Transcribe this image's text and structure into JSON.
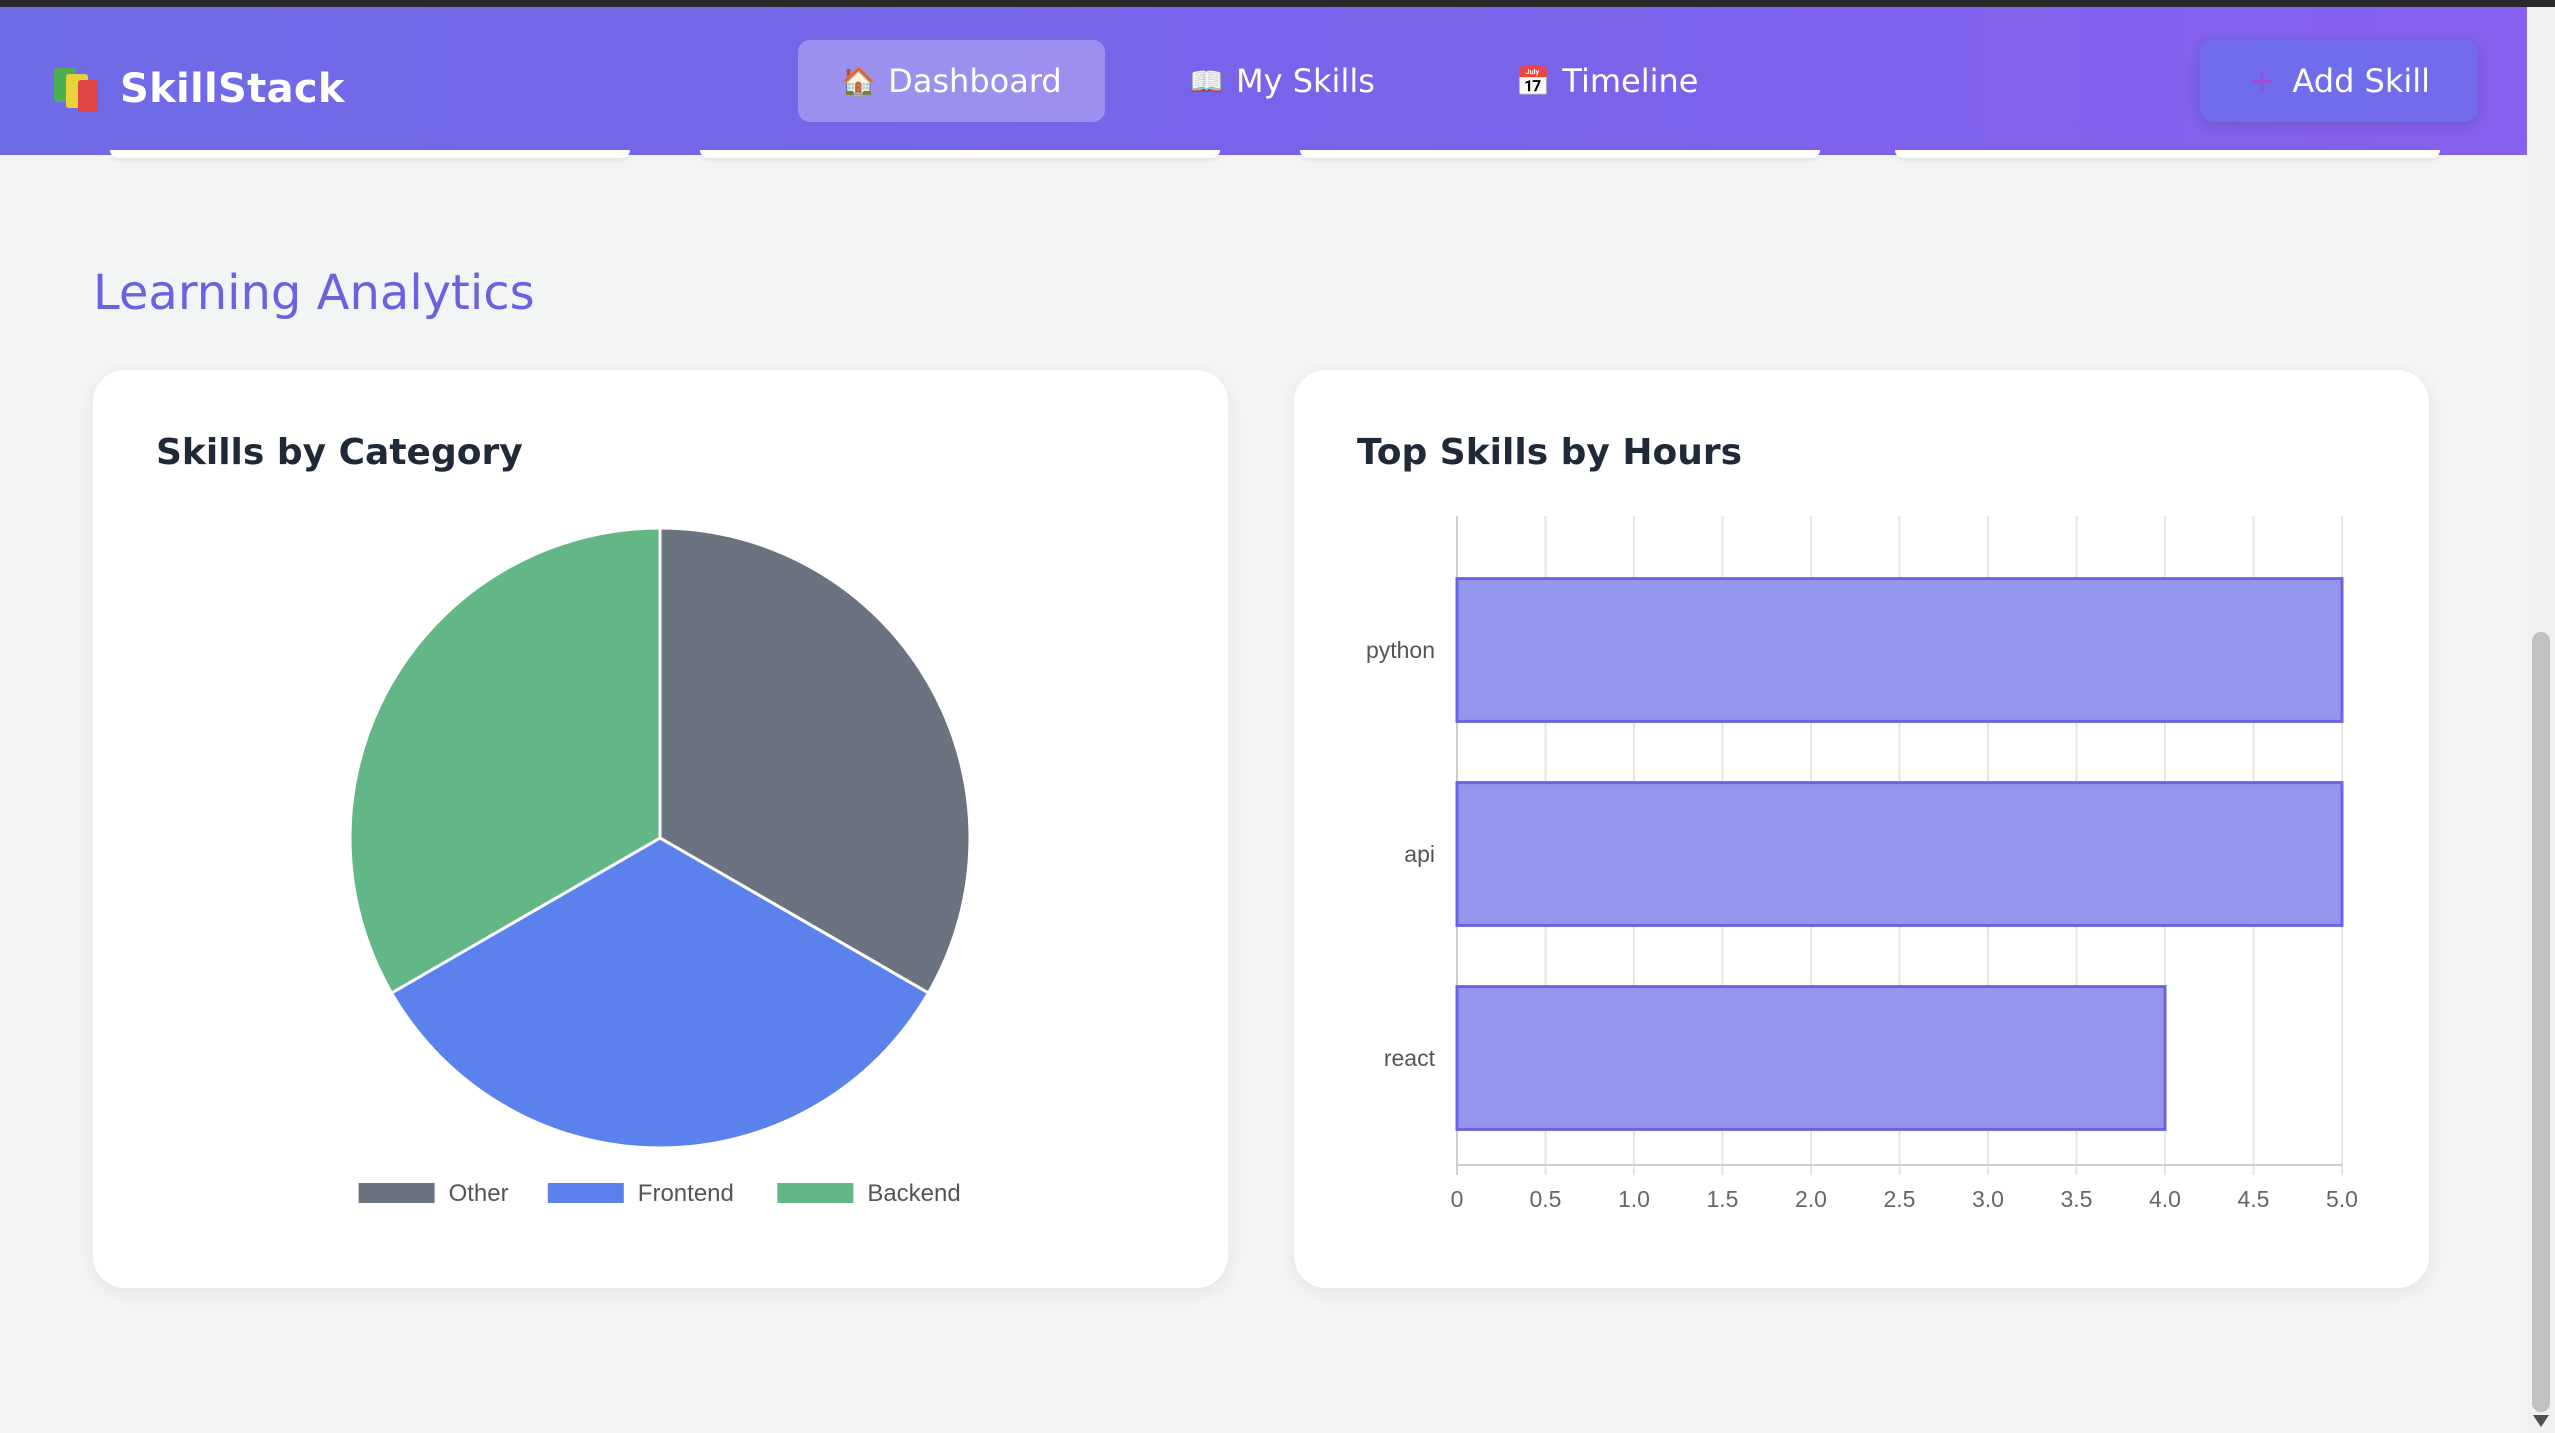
{
  "app": {
    "name": "SkillStack",
    "logo_icon": "books-icon"
  },
  "nav": {
    "items": [
      {
        "label": "Dashboard",
        "icon": "house-icon",
        "glyph": "🏠",
        "active": true
      },
      {
        "label": "My Skills",
        "icon": "open-book-icon",
        "glyph": "📖",
        "active": false
      },
      {
        "label": "Timeline",
        "icon": "calendar-icon",
        "glyph": "📅",
        "active": false
      }
    ],
    "add_skill": {
      "label": "Add Skill",
      "icon": "plus-icon",
      "glyph": "+"
    }
  },
  "section": {
    "title": "Learning Analytics"
  },
  "charts": {
    "category": {
      "title": "Skills by Category"
    },
    "hours": {
      "title": "Top Skills by Hours"
    }
  },
  "colors": {
    "accent": "#6b62e0",
    "other": "#6b7280",
    "frontend": "#5b82ec",
    "backend": "#63b685",
    "bar_fill": "#9595ee",
    "bar_stroke": "#6a63e2"
  },
  "chart_data": [
    {
      "type": "pie",
      "title": "Skills by Category",
      "labels": [
        "Other",
        "Frontend",
        "Backend"
      ],
      "values": [
        1,
        1,
        1
      ],
      "colors": [
        "#6b7280",
        "#5b82ec",
        "#63b685"
      ],
      "legend": "bottom"
    },
    {
      "type": "bar",
      "orientation": "horizontal",
      "title": "Top Skills by Hours",
      "categories": [
        "python",
        "api",
        "react"
      ],
      "values": [
        5,
        5,
        4
      ],
      "xlim": [
        0,
        5
      ],
      "xticks": [
        "0",
        "0.5",
        "1.0",
        "1.5",
        "2.0",
        "2.5",
        "3.0",
        "3.5",
        "4.0",
        "4.5",
        "5.0"
      ],
      "grid": true
    }
  ]
}
